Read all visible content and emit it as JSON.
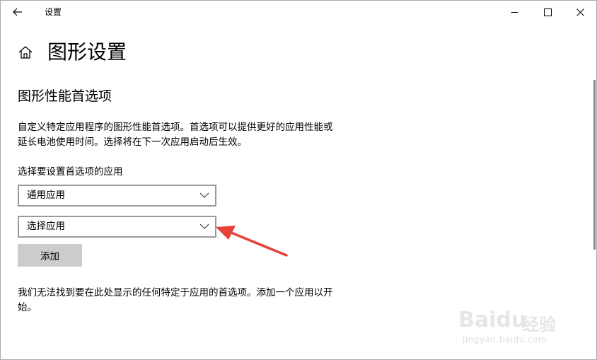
{
  "window": {
    "title": "设置",
    "controls": {
      "minimize_icon": "minimize-icon",
      "maximize_icon": "maximize-icon",
      "close_icon": "close-icon"
    }
  },
  "header": {
    "title": "图形设置",
    "home_icon": "home-icon",
    "back_icon": "back-arrow-icon"
  },
  "main": {
    "section_title": "图形性能首选项",
    "description": "自定义特定应用程序的图形性能首选项。首选项可以提供更好的应用性能或延长电池使用时间。选择将在下一次应用启动后生效。",
    "select_label": "选择要设置首选项的应用",
    "app_type_dropdown": {
      "value": "通用应用"
    },
    "app_dropdown": {
      "value": "选择应用"
    },
    "add_button_label": "添加",
    "empty_message": "我们无法找到要在此处显示的任何特定于应用的首选项。添加一个应用以开始。"
  },
  "annotation": {
    "arrow_color": "#e8413c"
  },
  "watermark": {
    "brand": "Baidu",
    "brand_cn": "经验",
    "url": "jingyan.baidu.com"
  }
}
